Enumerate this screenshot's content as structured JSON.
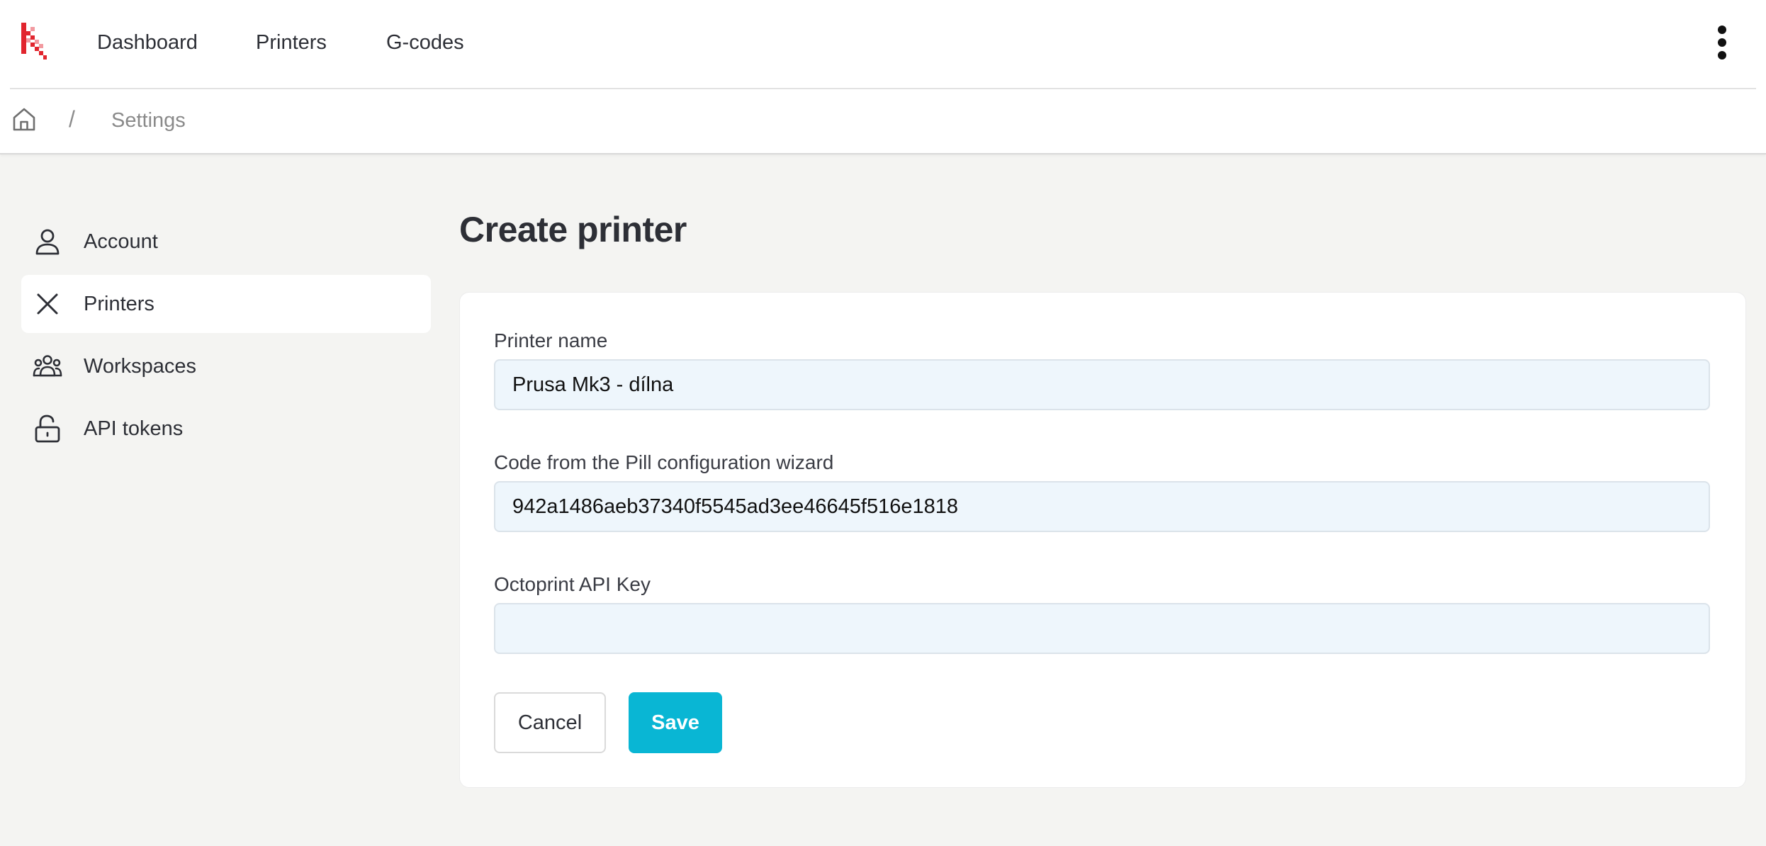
{
  "colors": {
    "accent": "#09b6d4",
    "logo_red": "#e1252e",
    "input_bg": "#eef6fc",
    "page_bg": "#f4f4f2"
  },
  "header": {
    "logo_icon": "k-logo-icon",
    "nav": [
      {
        "label": "Dashboard"
      },
      {
        "label": "Printers"
      },
      {
        "label": "G-codes"
      }
    ],
    "menu_icon": "kebab-menu-icon"
  },
  "breadcrumb": {
    "home_icon": "home-icon",
    "separator": "/",
    "current": "Settings"
  },
  "sidebar": {
    "items": [
      {
        "label": "Account",
        "icon": "user-icon",
        "active": false
      },
      {
        "label": "Printers",
        "icon": "close-icon",
        "active": true
      },
      {
        "label": "Workspaces",
        "icon": "group-icon",
        "active": false
      },
      {
        "label": "API tokens",
        "icon": "lock-icon",
        "active": false
      }
    ]
  },
  "main": {
    "title": "Create printer",
    "form": {
      "printer_name": {
        "label": "Printer name",
        "value": "Prusa Mk3 - dílna"
      },
      "pill_code": {
        "label": "Code from the Pill configuration wizard",
        "value": "942a1486aeb37340f5545ad3ee46645f516e1818"
      },
      "octoprint_key": {
        "label": "Octoprint API Key",
        "value": ""
      },
      "cancel_label": "Cancel",
      "save_label": "Save"
    }
  }
}
